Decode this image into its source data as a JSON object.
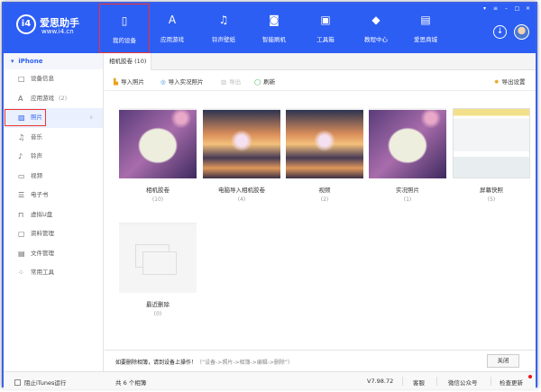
{
  "app": {
    "logo_name": "爱思助手",
    "logo_url": "www.i4.cn",
    "logo_mark": "i4"
  },
  "nav": [
    {
      "label": "我的设备",
      "icon": "phone-icon"
    },
    {
      "label": "应用游戏",
      "icon": "apps-icon"
    },
    {
      "label": "铃声壁纸",
      "icon": "ringtone-icon"
    },
    {
      "label": "智能刷机",
      "icon": "flash-icon"
    },
    {
      "label": "工具箱",
      "icon": "toolbox-icon"
    },
    {
      "label": "教程中心",
      "icon": "tutorial-icon"
    },
    {
      "label": "爱思商城",
      "icon": "store-icon"
    }
  ],
  "sidebar": {
    "device": "iPhone",
    "items": [
      {
        "label": "设备信息",
        "icon": "□"
      },
      {
        "label": "应用游戏",
        "count": "(2)",
        "icon": "A"
      },
      {
        "label": "照片",
        "icon": "▨"
      },
      {
        "label": "音乐",
        "icon": "♫"
      },
      {
        "label": "铃声",
        "icon": "♪"
      },
      {
        "label": "视频",
        "icon": "▭"
      },
      {
        "label": "电子书",
        "icon": "☰"
      },
      {
        "label": "虚拟U盘",
        "icon": "⊓"
      },
      {
        "label": "资料管理",
        "icon": "▢"
      },
      {
        "label": "文件管理",
        "icon": "▤"
      },
      {
        "label": "常用工具",
        "icon": "⁘"
      }
    ]
  },
  "tabs": [
    {
      "label": "相机胶卷 (10)"
    }
  ],
  "toolbar": {
    "import_photos": "导入照片",
    "import_live": "导入实况照片",
    "export": "导出",
    "refresh": "刷新",
    "export_settings": "导出设置"
  },
  "albums": [
    {
      "title": "相机胶卷",
      "count": "(10)"
    },
    {
      "title": "电脑导入相机胶卷",
      "count": "(4)"
    },
    {
      "title": "视频",
      "count": "(2)"
    },
    {
      "title": "实况照片",
      "count": "(1)"
    },
    {
      "title": "屏幕快照",
      "count": "(5)"
    },
    {
      "title": "最近删除",
      "count": "(0)"
    }
  ],
  "message": {
    "main": "如要删除相簿，请到设备上操作！",
    "path": "（“设备->照片->相簿->编辑->删除”）",
    "close": "关闭"
  },
  "status": {
    "block_itunes": "阻止iTunes运行",
    "total": "共 6 个相簿",
    "version": "V7.98.72",
    "service": "客服",
    "wechat": "微信公众号",
    "update": "检查更新"
  }
}
